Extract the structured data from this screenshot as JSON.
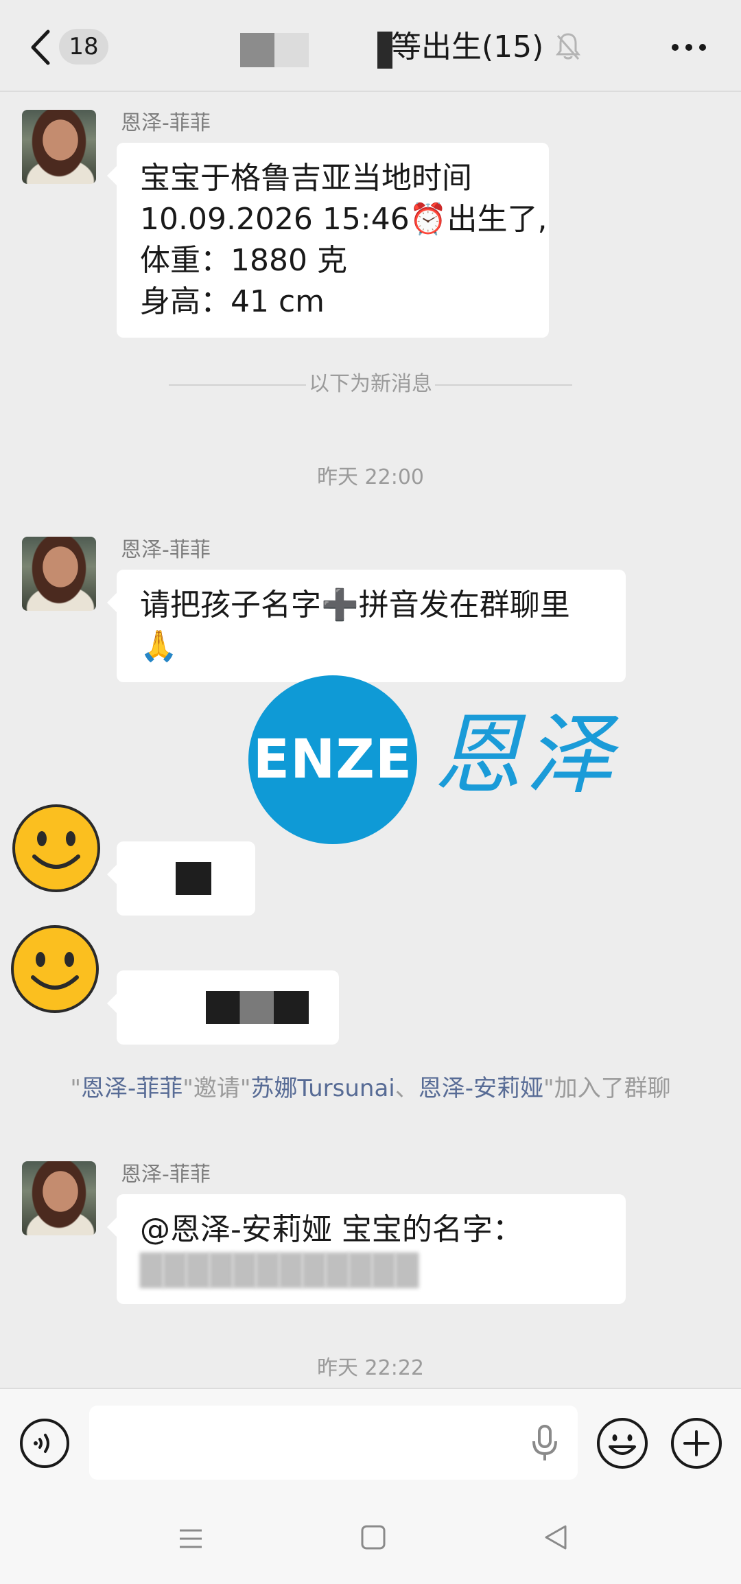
{
  "header": {
    "unread_count": "18",
    "title": "等出生(15)",
    "back_icon": "chevron-left-icon",
    "mute_icon": "bell-muted-icon",
    "more_icon": "more-horizontal-icon"
  },
  "messages": [
    {
      "sender": "恩泽-菲菲",
      "lines": [
        "宝宝于格鲁吉亚当地时间",
        "10.09.2026 15:46⏰出生了,",
        "体重：1880 克",
        "身高：41 cm"
      ]
    },
    {
      "sender": "恩泽-菲菲",
      "lines": [
        "请把孩子名字➕拼音发在群聊里",
        "🙏"
      ]
    },
    {
      "sender": "恩泽-菲菲",
      "lines": [
        "@恩泽-安莉娅  宝宝的名字："
      ]
    }
  ],
  "divider_text": "以下为新消息",
  "timestamps": [
    "昨天 22:00",
    "昨天 22:22"
  ],
  "system_message": {
    "q1": "\"",
    "inviter": "恩泽-菲菲",
    "mid": "\"邀请\"",
    "invitee1": "苏娜Tursunai",
    "sep": "、",
    "invitee2": "恩泽-安莉娅",
    "tail": "\"加入了群聊"
  },
  "watermark": {
    "circle_text": "ENZE",
    "cn_text": "恩泽",
    "color": "#0f9ad6"
  },
  "input": {
    "voice_icon": "voice-icon",
    "mic_icon": "microphone-icon",
    "emoji_icon": "emoji-icon",
    "plus_icon": "plus-circle-icon"
  },
  "colors": {
    "background": "#ededed",
    "bubble": "#ffffff",
    "link": "#576b95",
    "timestamp": "#9b9b9b",
    "smiley": "#fbbf1f"
  }
}
